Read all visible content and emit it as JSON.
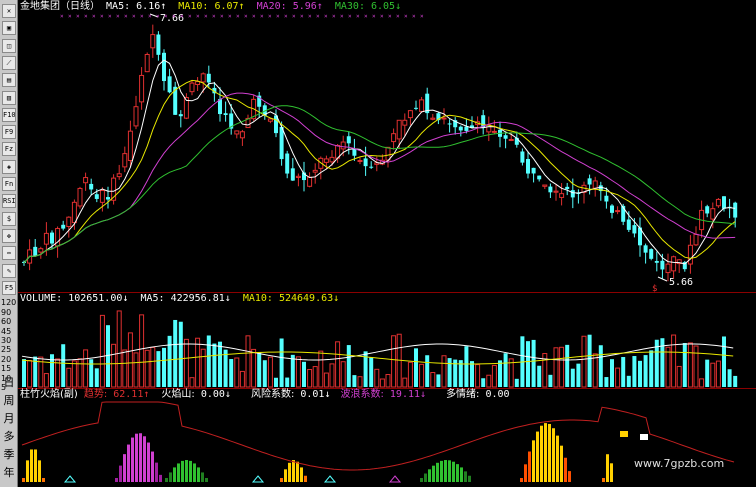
{
  "colors": {
    "up": "#e03030",
    "down": "#54ffff",
    "ma5": "#ffffff",
    "ma10": "#e8e800",
    "ma20": "#d040d0",
    "ma30": "#30c030",
    "axis": "#8b0000"
  },
  "main_header": {
    "name": "金地集团（日线）",
    "ma5_label": "MA5:",
    "ma5_value": "6.16↑",
    "ma10_label": "MA10:",
    "ma10_value": "6.07↑",
    "ma20_label": "MA20:",
    "ma20_value": "5.96↑",
    "ma30_label": "MA30:",
    "ma30_value": "6.05↓"
  },
  "price_high_label": "7.66",
  "price_low_label": "5.66",
  "volume_header": {
    "vol_label": "VOLUME:",
    "vol_value": "102651.00↓",
    "ma5_label": "MA5:",
    "ma5_value": "422956.81↓",
    "ma10_label": "MA10:",
    "ma10_value": "524649.63↓"
  },
  "volume_axis": [
    "5",
    "10",
    "15",
    "20",
    "25",
    "30",
    "45",
    "60",
    "90",
    "120"
  ],
  "indicator_header": {
    "name": "柱竹火焰(副)",
    "trend_label": "趋势:",
    "trend_value": "62.11↑",
    "fire_label": "火焰山:",
    "fire_value": "0.00↓",
    "risk_label": "风险系数:",
    "risk_value": "0.01↓",
    "wave_label": "波浪系数:",
    "wave_value": "19.11↓",
    "bull_label": "多情绪:",
    "bull_value": "0.00"
  },
  "toolbar": {
    "buttons": [
      "✕",
      "▣",
      "◫",
      "⟋",
      "▤",
      "▥",
      "F10",
      "F9",
      "Fz",
      "◈",
      "Fn",
      "RSI",
      "$",
      "✥",
      "⇔",
      "✎",
      "F5"
    ],
    "periods": [
      "日",
      "周",
      "月",
      "多",
      "季",
      "年"
    ]
  },
  "watermark": "www.7gpzb.com"
}
